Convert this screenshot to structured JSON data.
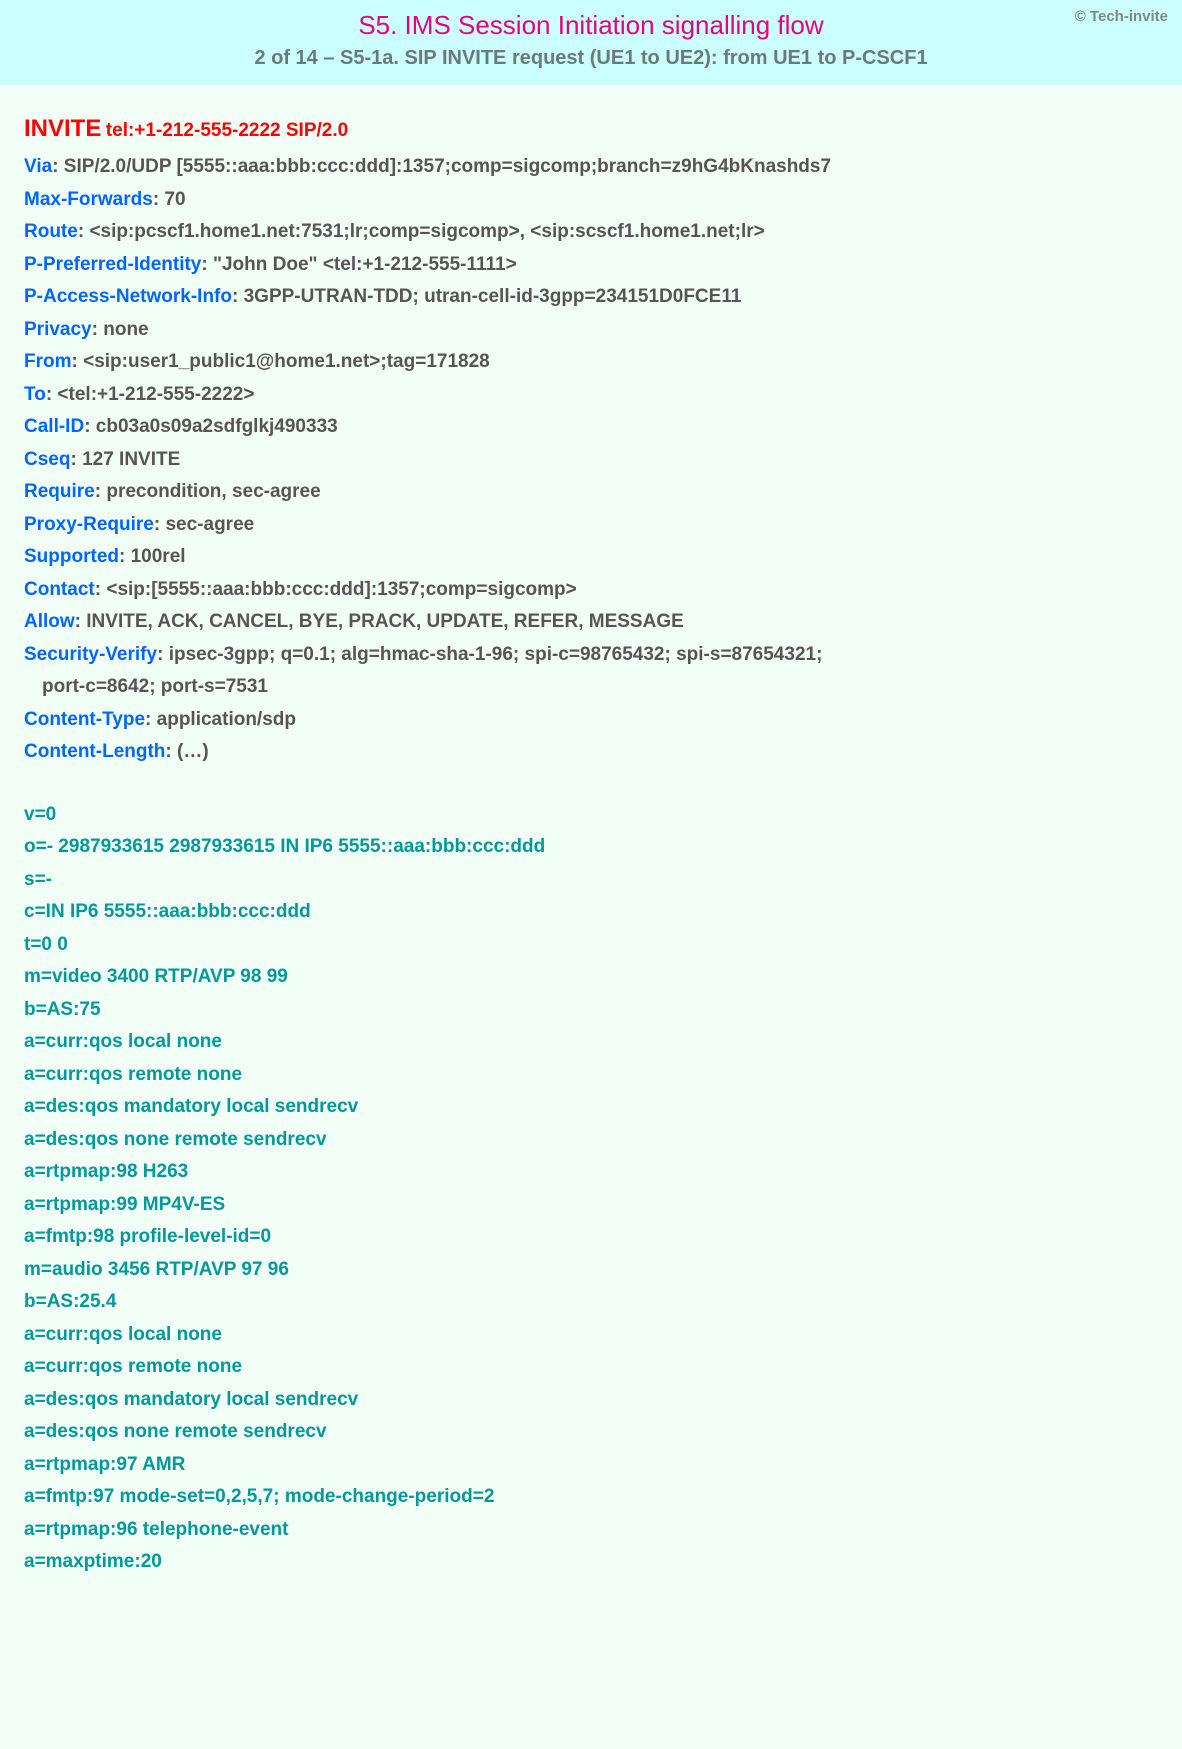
{
  "copyright": "© Tech-invite",
  "title": "S5. IMS Session Initiation signalling flow",
  "subtitle": "2 of 14 – S5-1a. SIP INVITE request (UE1 to UE2): from UE1 to P-CSCF1",
  "method": "INVITE",
  "request_uri": "tel:+1-212-555-2222 SIP/2.0",
  "headers": [
    {
      "name": "Via",
      "value": "SIP/2.0/UDP [5555::aaa:bbb:ccc:ddd]:1357;comp=sigcomp;branch=z9hG4bKnashds7"
    },
    {
      "name": "Max-Forwards",
      "value": "70"
    },
    {
      "name": "Route",
      "value": "<sip:pcscf1.home1.net:7531;lr;comp=sigcomp>, <sip:scscf1.home1.net;lr>"
    },
    {
      "name": "P-Preferred-Identity",
      "value": "\"John Doe\" <tel:+1-212-555-1111>"
    },
    {
      "name": "P-Access-Network-Info",
      "value": "3GPP-UTRAN-TDD; utran-cell-id-3gpp=234151D0FCE11"
    },
    {
      "name": "Privacy",
      "value": "none"
    },
    {
      "name": "From",
      "value": "<sip:user1_public1@home1.net>;tag=171828"
    },
    {
      "name": "To",
      "value": "<tel:+1-212-555-2222>"
    },
    {
      "name": "Call-ID",
      "value": "cb03a0s09a2sdfglkj490333"
    },
    {
      "name": "Cseq",
      "value": "127 INVITE"
    },
    {
      "name": "Require",
      "value": "precondition, sec-agree"
    },
    {
      "name": "Proxy-Require",
      "value": "sec-agree"
    },
    {
      "name": "Supported",
      "value": "100rel"
    },
    {
      "name": "Contact",
      "value": "<sip:[5555::aaa:bbb:ccc:ddd]:1357;comp=sigcomp>"
    },
    {
      "name": "Allow",
      "value": "INVITE, ACK, CANCEL, BYE, PRACK, UPDATE, REFER, MESSAGE"
    },
    {
      "name": "Security-Verify",
      "value": "ipsec-3gpp; q=0.1; alg=hmac-sha-1-96; spi-c=98765432; spi-s=87654321;",
      "cont": "port-c=8642; port-s=7531"
    },
    {
      "name": "Content-Type",
      "value": "application/sdp"
    },
    {
      "name": "Content-Length",
      "value": "(…)"
    }
  ],
  "sdp": [
    "v=0",
    "o=- 2987933615 2987933615 IN IP6 5555::aaa:bbb:ccc:ddd",
    "s=-",
    "c=IN IP6 5555::aaa:bbb:ccc:ddd",
    "t=0 0",
    "m=video 3400 RTP/AVP 98 99",
    "b=AS:75",
    "a=curr:qos local none",
    "a=curr:qos remote none",
    "a=des:qos mandatory local sendrecv",
    "a=des:qos none remote sendrecv",
    "a=rtpmap:98 H263",
    "a=rtpmap:99 MP4V-ES",
    "a=fmtp:98 profile-level-id=0",
    "m=audio 3456 RTP/AVP 97 96",
    "b=AS:25.4",
    "a=curr:qos local none",
    "a=curr:qos remote none",
    "a=des:qos mandatory local sendrecv",
    "a=des:qos none remote sendrecv",
    "a=rtpmap:97 AMR",
    "a=fmtp:97 mode-set=0,2,5,7; mode-change-period=2",
    "a=rtpmap:96 telephone-event",
    "a=maxptime:20"
  ]
}
